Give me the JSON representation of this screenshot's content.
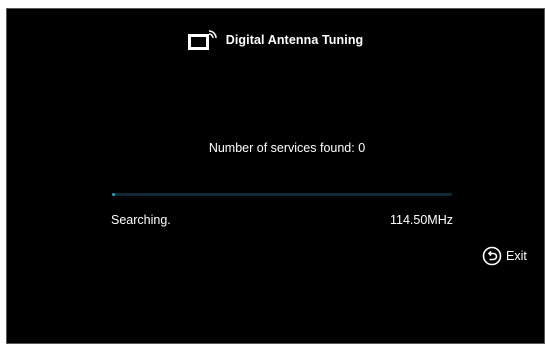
{
  "header": {
    "title": "Digital Antenna Tuning",
    "icon": "tv-antenna-icon"
  },
  "scan": {
    "services_found_text": "Number of services found: 0",
    "status_text": "Searching.",
    "frequency_text": "114.50MHz",
    "progress_fraction": 0.01
  },
  "exit": {
    "label": "Exit",
    "icon": "return-icon"
  },
  "colors": {
    "background": "#000000",
    "text": "#ffffff",
    "progress_fill": "#1fa0c8",
    "progress_track": "#0f2a33"
  }
}
